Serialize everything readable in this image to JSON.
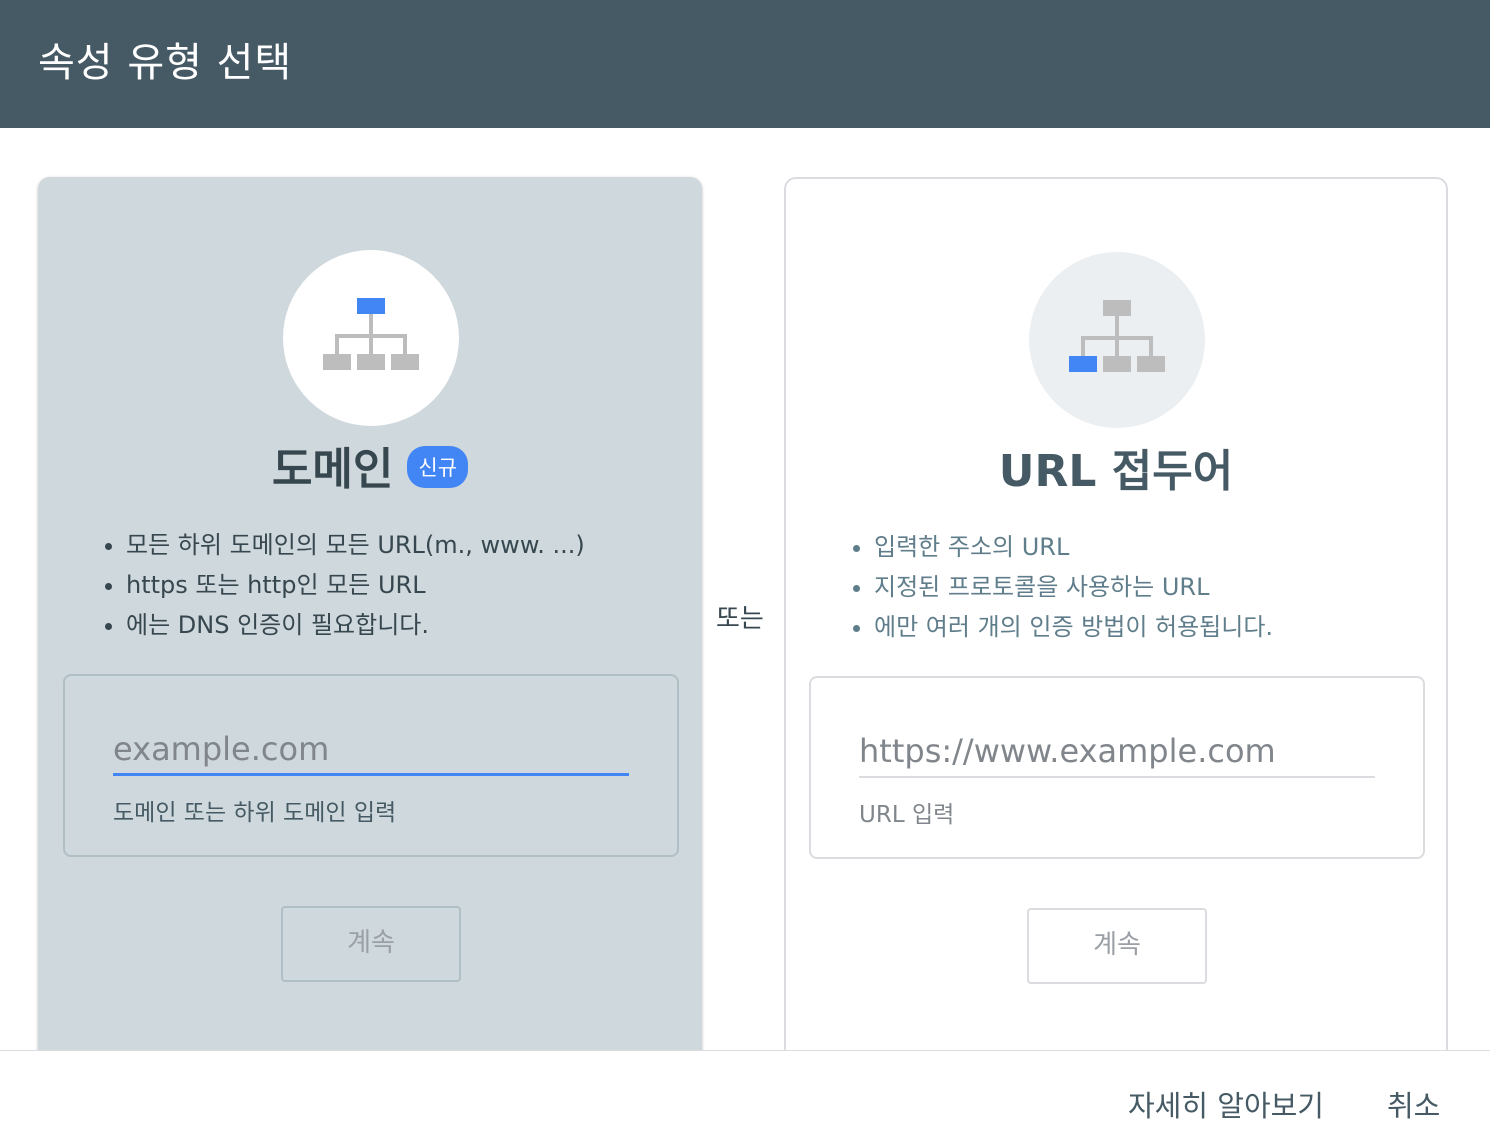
{
  "dialog": {
    "title": "속성 유형 선택"
  },
  "domain_card": {
    "title": "도메인",
    "badge": "신규",
    "bullets": [
      "모든 하위 도메인의 모든 URL(m., www. ...)",
      "https 또는 http인 모든 URL",
      "에는 DNS 인증이 필요합니다."
    ],
    "input_placeholder": "example.com",
    "input_helper": "도메인 또는 하위 도메인 입력",
    "continue_label": "계속"
  },
  "separator": {
    "label": "또는"
  },
  "url_card": {
    "title": "URL 접두어",
    "bullets": [
      "입력한 주소의 URL",
      "지정된 프로토콜을 사용하는 URL",
      "에만 여러 개의 인증 방법이 허용됩니다."
    ],
    "input_placeholder": "https://www.example.com",
    "input_helper": "URL 입력",
    "continue_label": "계속"
  },
  "footer": {
    "learn_more_label": "자세히 알아보기",
    "cancel_label": "취소"
  },
  "icons": {
    "domain_icon": "sitemap-icon",
    "url_icon": "sitemap-icon"
  },
  "colors": {
    "header_bg": "#455a64",
    "accent": "#4285f4",
    "domain_card_bg": "#cfd8dc",
    "icon_gray": "#bdbdbd"
  }
}
